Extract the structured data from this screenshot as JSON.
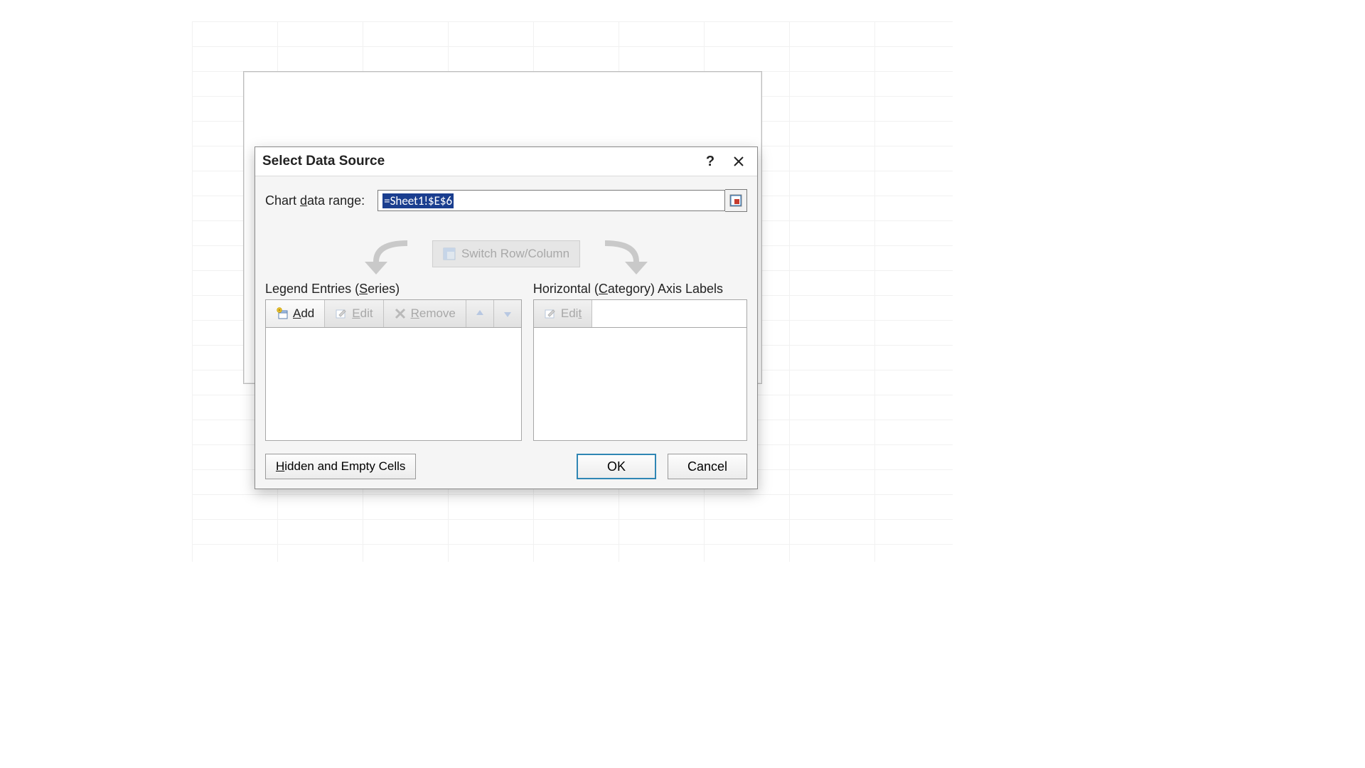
{
  "dialog": {
    "title": "Select Data Source",
    "range_label_pre": "Chart ",
    "range_label_ul": "d",
    "range_label_post": "ata range:",
    "range_value": "=Sheet1!$E$6",
    "switch_label": "Switch Row/Column",
    "legend_header_pre": "Legend Entries (",
    "legend_header_ul": "S",
    "legend_header_post": "eries)",
    "axis_header_pre": "Horizontal (",
    "axis_header_ul": "C",
    "axis_header_post": "ategory) Axis Labels",
    "add_ul": "A",
    "add_post": "dd",
    "edit_ul": "E",
    "edit_post": "dit",
    "remove_ul": "R",
    "remove_post": "emove",
    "edit2_pre": "Edi",
    "edit2_ul": "t",
    "hidden_ul": "H",
    "hidden_post": "idden and Empty Cells",
    "ok": "OK",
    "cancel": "Cancel"
  }
}
